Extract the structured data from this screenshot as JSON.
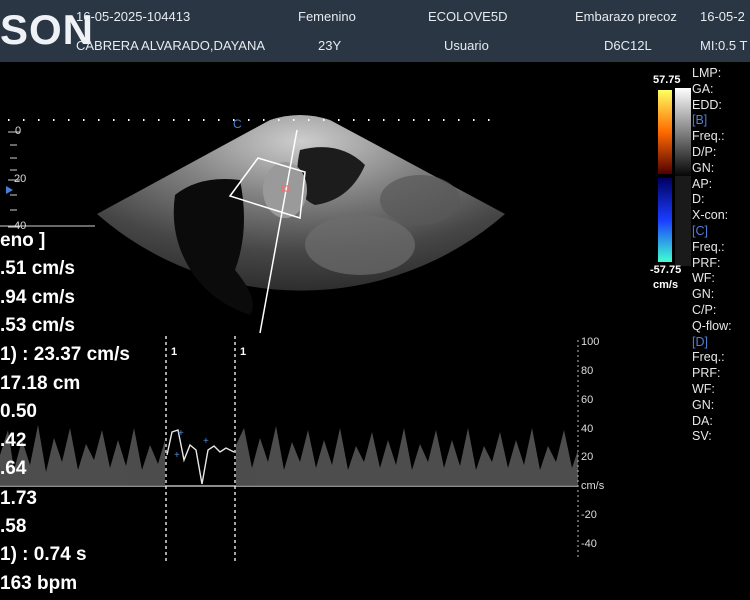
{
  "header": {
    "brand": "SON",
    "datetime": "16-05-2025-104413",
    "patient_name": "CABRERA ALVARADO,DAYANA",
    "gender": "Femenino",
    "age": "23Y",
    "institution": "ECOLOVE5D",
    "user": "Usuario",
    "exam": "Embarazo precoz",
    "probe": "D6C12L",
    "date_right": "16-05-2",
    "mi": "MI:0.5 T"
  },
  "depth_scale": [
    "0",
    "20",
    "40"
  ],
  "image_marker": "C",
  "color_bar": {
    "max": "57.75",
    "min": "-57.75",
    "unit": "cm/s"
  },
  "params": [
    {
      "label": "LMP:",
      "blue": false
    },
    {
      "label": "GA:",
      "blue": false
    },
    {
      "label": "EDD:",
      "blue": false
    },
    {
      "label": "[B]",
      "blue": true
    },
    {
      "label": "Freq.:",
      "blue": false
    },
    {
      "label": "D/P:",
      "blue": false
    },
    {
      "label": "GN:",
      "blue": false
    },
    {
      "label": "AP:",
      "blue": false
    },
    {
      "label": "D:",
      "blue": false
    },
    {
      "label": "X-con:",
      "blue": false
    },
    {
      "label": "[C]",
      "blue": true
    },
    {
      "label": "Freq.:",
      "blue": false
    },
    {
      "label": "PRF:",
      "blue": false
    },
    {
      "label": "WF:",
      "blue": false
    },
    {
      "label": "GN:",
      "blue": false
    },
    {
      "label": "C/P:",
      "blue": false
    },
    {
      "label": "Q-flow:",
      "blue": false
    },
    {
      "label": "[D]",
      "blue": true
    },
    {
      "label": "Freq.:",
      "blue": false
    },
    {
      "label": "PRF:",
      "blue": false
    },
    {
      "label": "WF:",
      "blue": false
    },
    {
      "label": "GN:",
      "blue": false
    },
    {
      "label": "DA:",
      "blue": false
    },
    {
      "label": "SV:",
      "blue": false
    }
  ],
  "measurements": [
    "eno ]",
    ".51 cm/s",
    ".94 cm/s",
    ".53 cm/s",
    "1) : 23.37 cm/s",
    "17.18 cm",
    " 0.50",
    ".42",
    ".64",
    "1.73",
    ".58",
    "1) : 0.74 s",
    "163 bpm"
  ],
  "doppler_scale": [
    "100",
    "80",
    "60",
    "40",
    "20",
    "cm/s",
    "-20",
    "-40"
  ],
  "caliper_labels": [
    "1",
    "1"
  ]
}
